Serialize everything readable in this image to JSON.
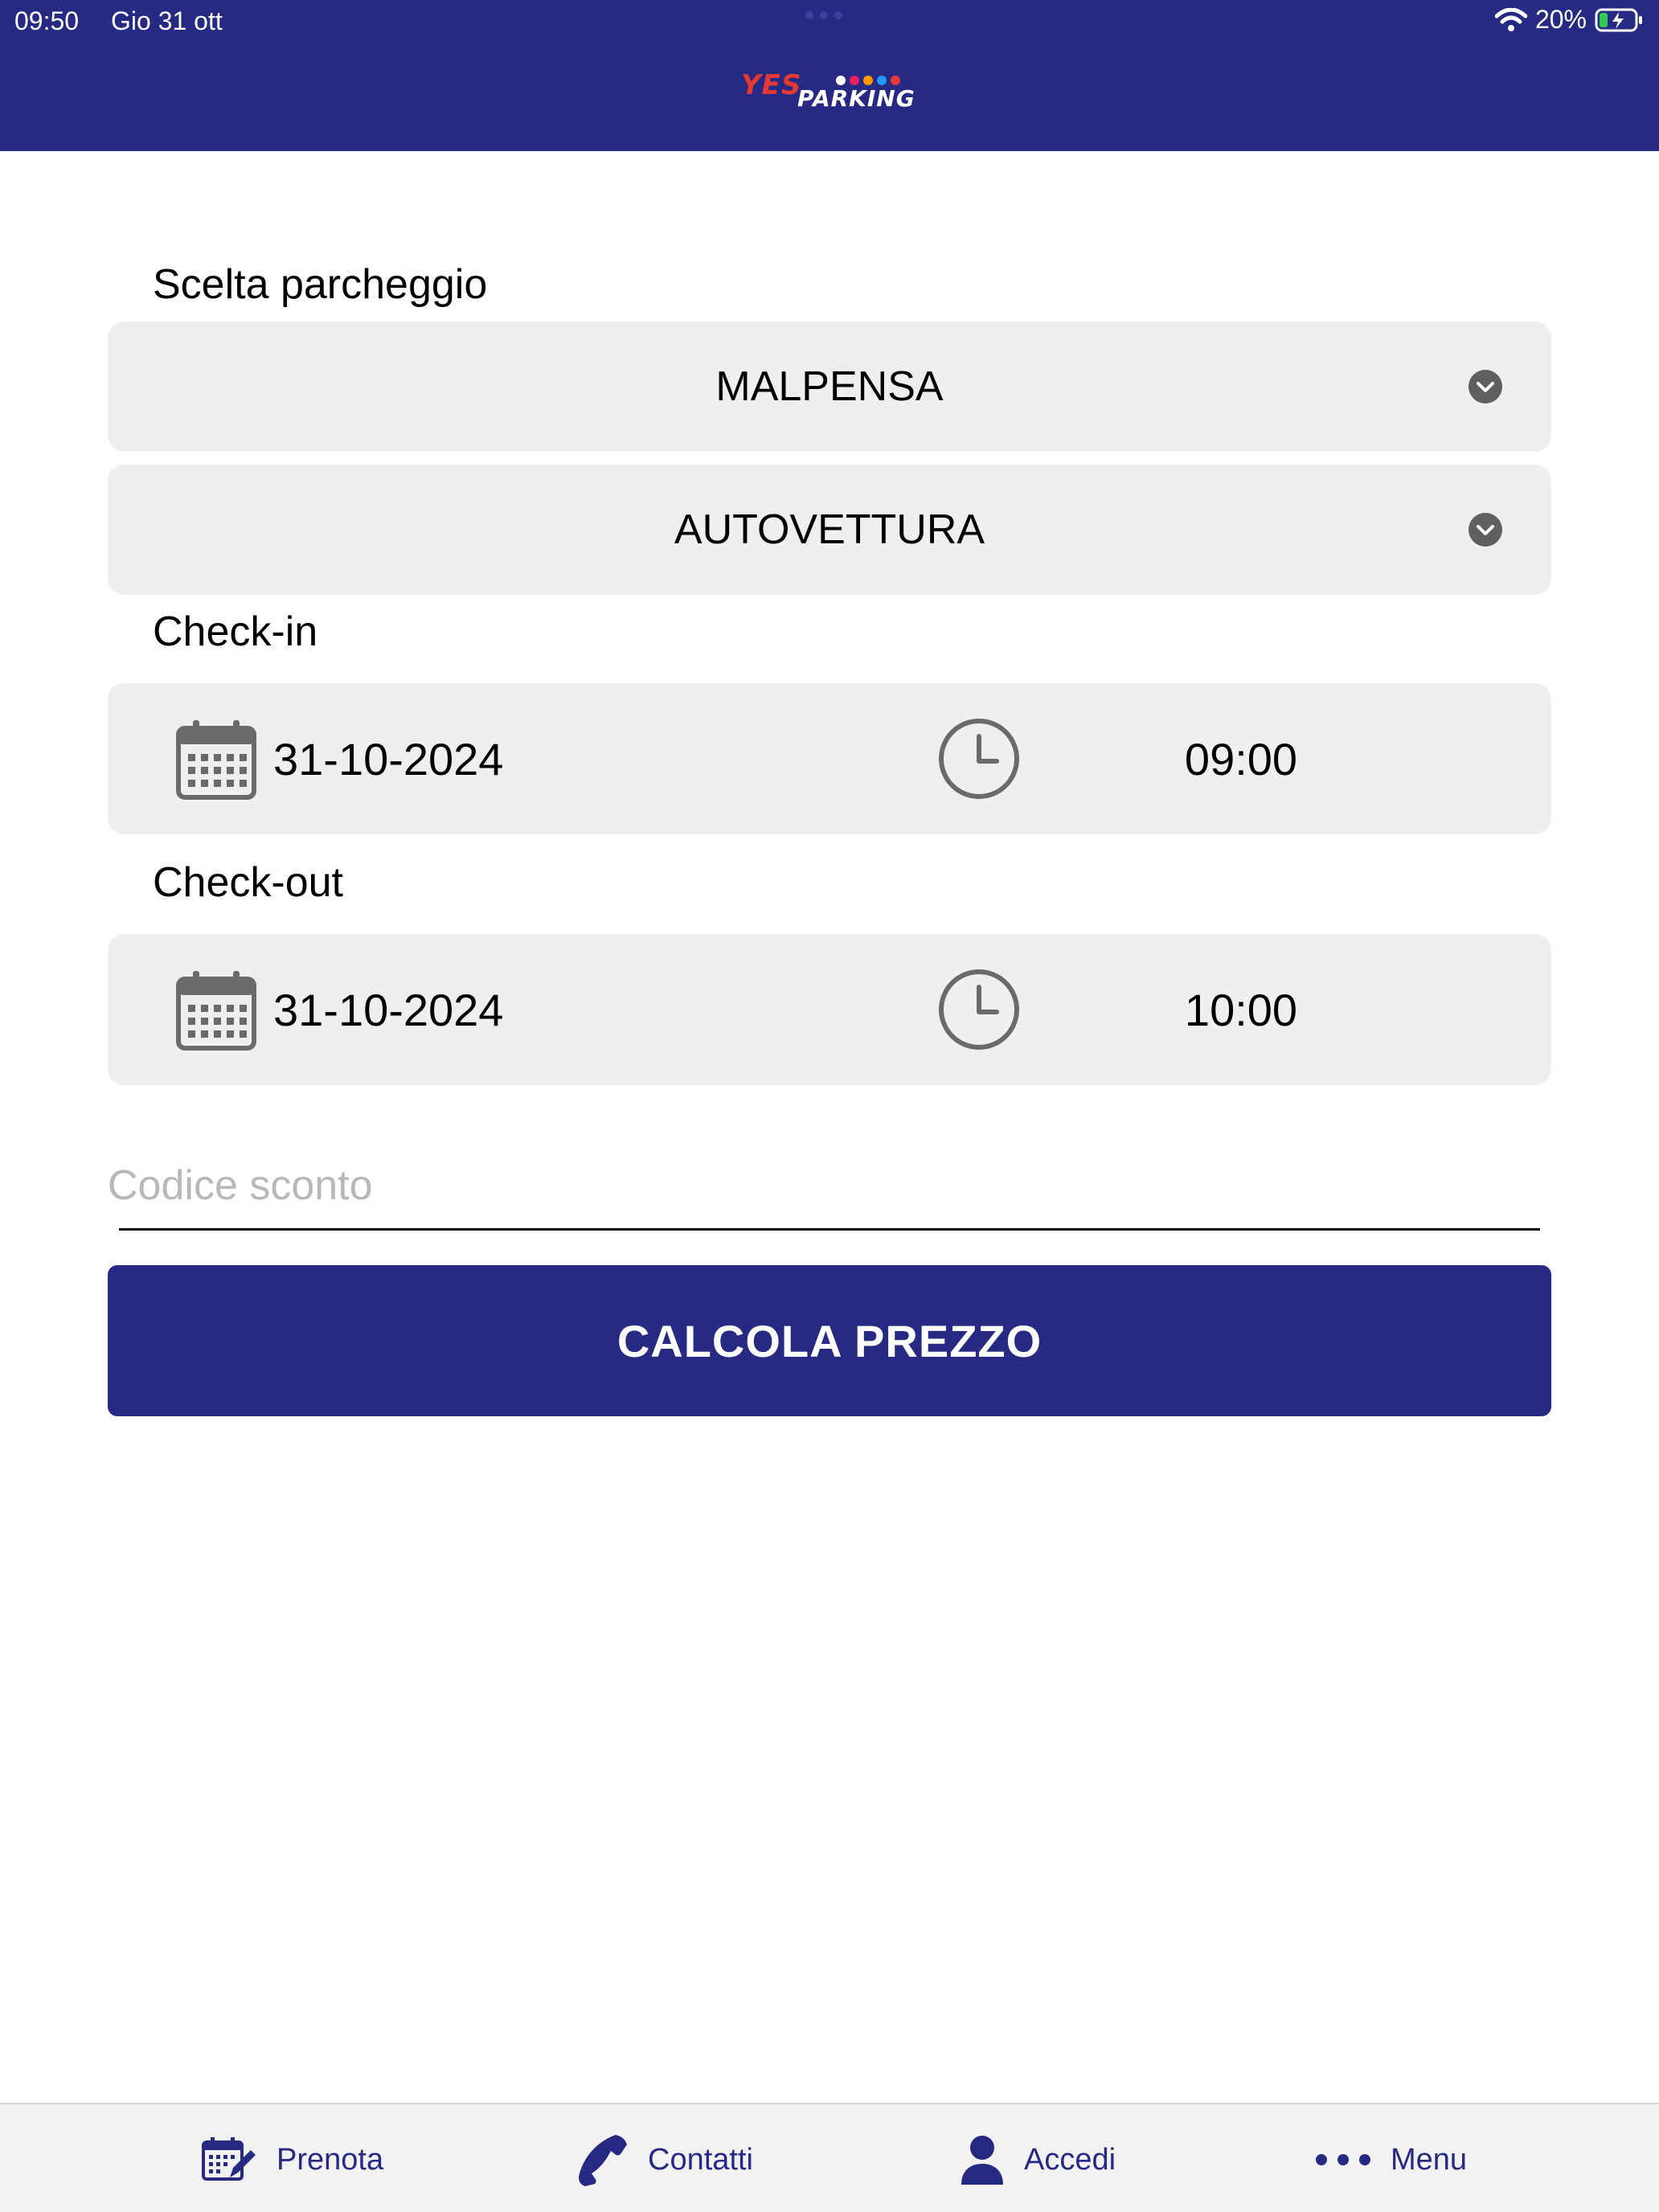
{
  "status_bar": {
    "time": "09:50",
    "date": "Gio 31 ott",
    "battery": "20%"
  },
  "header": {
    "logo_word1": "YES",
    "logo_word2": "PARKING",
    "background_color": "#272a83"
  },
  "form": {
    "parking_label": "Scelta parcheggio",
    "parking_value": "MALPENSA",
    "vehicle_value": "AUTOVETTURA",
    "checkin_label": "Check-in",
    "checkin_date": "31-10-2024",
    "checkin_time": "09:00",
    "checkout_label": "Check-out",
    "checkout_date": "31-10-2024",
    "checkout_time": "10:00",
    "discount_value": "",
    "discount_placeholder": "Codice sconto",
    "calc_button": "CALCOLA PREZZO"
  },
  "tabbar": {
    "items": [
      {
        "label": "Prenota",
        "icon": "calendar-edit-icon"
      },
      {
        "label": "Contatti",
        "icon": "phone-icon"
      },
      {
        "label": "Accedi",
        "icon": "user-icon"
      },
      {
        "label": "Menu",
        "icon": "more-dots-icon"
      }
    ]
  }
}
